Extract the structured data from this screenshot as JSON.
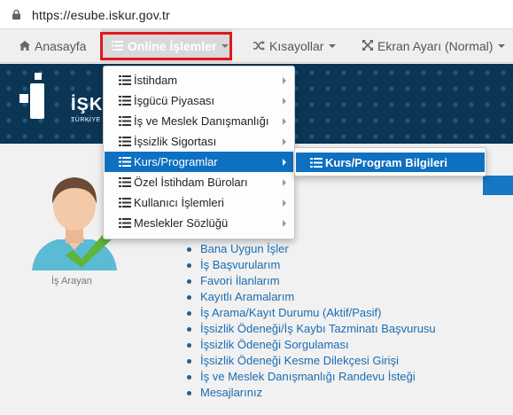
{
  "browser": {
    "url": "https://esube.iskur.gov.tr"
  },
  "navbar": {
    "items": [
      {
        "label": "Anasayfa",
        "icon": "home-icon"
      },
      {
        "label": "Online İşlemler",
        "icon": "list-icon",
        "active": true
      },
      {
        "label": "Kısayollar",
        "icon": "shuffle-icon"
      },
      {
        "label": "Ekran Ayarı (Normal)",
        "icon": "expand-icon"
      }
    ]
  },
  "brand": {
    "logo_text": "İŞK",
    "logo_sub": "TÜRKİYE"
  },
  "dropdown": {
    "items": [
      {
        "label": "İstihdam"
      },
      {
        "label": "İşgücü Piyasası"
      },
      {
        "label": "İş ve Meslek Danışmanlığı"
      },
      {
        "label": "İşsizlik Sigortası"
      },
      {
        "label": "Kurs/Programlar",
        "selected": true
      },
      {
        "label": "Özel İstihdam Büroları"
      },
      {
        "label": "Kullanıcı İşlemleri"
      },
      {
        "label": "Meslekler Sözlüğü"
      }
    ],
    "submenu": {
      "label": "Kurs/Program Bilgileri"
    }
  },
  "user": {
    "role_label": "İş Arayan"
  },
  "links": [
    "Bana Uygun İşler",
    "İş Başvurularım",
    "Favori İlanlarım",
    "Kayıtlı Aramalarım",
    "İş Arama/Kayıt Durumu (Aktif/Pasif)",
    "İşsizlik Ödeneği/İş Kaybı Tazminatı Başvurusu",
    "İşsizlik Ödeneği Sorgulaması",
    "İşsizlik Ödeneği Kesme Dilekçesi Girişi",
    "İş ve Meslek Danışmanlığı Randevu İsteği",
    "Mesajlarınız"
  ],
  "colors": {
    "accent": "#0e70c0",
    "highlight_box": "#e0161d",
    "banner": "#0a3555",
    "link": "#1a6cb3"
  }
}
